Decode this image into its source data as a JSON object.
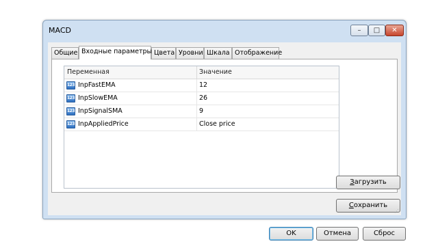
{
  "window": {
    "title": "MACD",
    "controls": {
      "minimize": "–",
      "maximize": "□",
      "close": "✕"
    }
  },
  "tabs": [
    {
      "label": "Общие",
      "active": false
    },
    {
      "label": "Входные параметры",
      "active": true
    },
    {
      "label": "Цвета",
      "active": false
    },
    {
      "label": "Уровни",
      "active": false
    },
    {
      "label": "Шкала",
      "active": false
    },
    {
      "label": "Отображение",
      "active": false
    }
  ],
  "grid": {
    "columns": [
      "Переменная",
      "Значение"
    ],
    "rows": [
      {
        "icon": "numeric-123-icon",
        "icon_text": "123",
        "name": "InpFastEMA",
        "value": "12"
      },
      {
        "icon": "numeric-123-icon",
        "icon_text": "123",
        "name": "InpSlowEMA",
        "value": "26"
      },
      {
        "icon": "numeric-123-icon",
        "icon_text": "123",
        "name": "InpSignalSMA",
        "value": "9"
      },
      {
        "icon": "numeric-123-icon",
        "icon_text": "123",
        "name": "InpAppliedPrice",
        "value": "Close price"
      }
    ]
  },
  "side_buttons": {
    "load_first": "З",
    "load_rest": "агрузить",
    "save_first": "С",
    "save_rest": "охранить"
  },
  "footer_buttons": {
    "ok": "OK",
    "cancel": "Отмена",
    "reset": "Сброс"
  },
  "colors": {
    "frame": "#cfe0f2",
    "close_button": "#c7462e",
    "default_button_border": "#3c7fb1"
  }
}
